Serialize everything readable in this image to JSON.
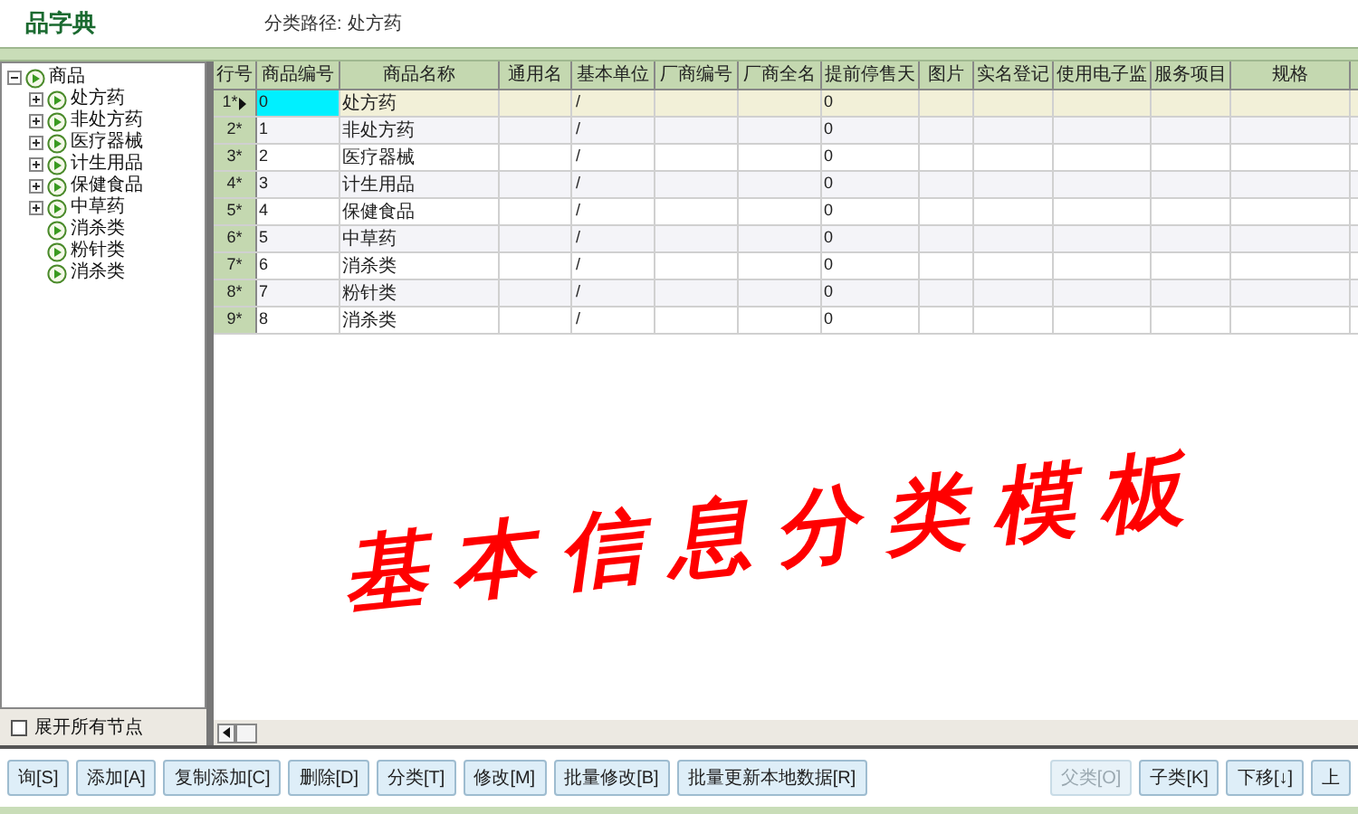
{
  "header": {
    "title": "品字典",
    "path_label": "分类路径:",
    "path_value": "处方药"
  },
  "tree": {
    "label": "商品",
    "expanded": true,
    "children": [
      {
        "label": "处方药",
        "expanded": false
      },
      {
        "label": "非处方药",
        "expanded": false
      },
      {
        "label": "医疗器械",
        "expanded": false
      },
      {
        "label": "计生用品",
        "expanded": false
      },
      {
        "label": "保健食品",
        "expanded": false
      },
      {
        "label": "中草药",
        "expanded": false
      },
      {
        "label": "消杀类"
      },
      {
        "label": "粉针类"
      },
      {
        "label": "消杀类"
      }
    ]
  },
  "expand_all": {
    "label": "展开所有节点",
    "checked": false
  },
  "table": {
    "columns": [
      "行号",
      "商品编号",
      "商品名称",
      "通用名",
      "基本单位",
      "厂商编号",
      "厂商全名",
      "提前停售天",
      "图片",
      "实名登记",
      "使用电子监",
      "服务项目",
      "规格"
    ],
    "rows": [
      {
        "row_no": "1*",
        "code": "0",
        "name": "处方药",
        "unit": "/",
        "days": "0",
        "selected": true
      },
      {
        "row_no": "2*",
        "code": "1",
        "name": "非处方药",
        "unit": "/",
        "days": "0",
        "selected": false
      },
      {
        "row_no": "3*",
        "code": "2",
        "name": "医疗器械",
        "unit": "/",
        "days": "0",
        "selected": false
      },
      {
        "row_no": "4*",
        "code": "3",
        "name": "计生用品",
        "unit": "/",
        "days": "0",
        "selected": false
      },
      {
        "row_no": "5*",
        "code": "4",
        "name": "保健食品",
        "unit": "/",
        "days": "0",
        "selected": false
      },
      {
        "row_no": "6*",
        "code": "5",
        "name": "中草药",
        "unit": "/",
        "days": "0",
        "selected": false
      },
      {
        "row_no": "7*",
        "code": "6",
        "name": "消杀类",
        "unit": "/",
        "days": "0",
        "selected": false
      },
      {
        "row_no": "8*",
        "code": "7",
        "name": "粉针类",
        "unit": "/",
        "days": "0",
        "selected": false
      },
      {
        "row_no": "9*",
        "code": "8",
        "name": "消杀类",
        "unit": "/",
        "days": "0",
        "selected": false
      }
    ]
  },
  "overlay_caption": "基本信息分类模板",
  "left_buttons": [
    {
      "label": "询[S]",
      "disabled": false
    },
    {
      "label": "添加[A]",
      "disabled": false
    },
    {
      "label": "复制添加[C]",
      "disabled": false
    },
    {
      "label": "删除[D]",
      "disabled": false
    },
    {
      "label": "分类[T]",
      "disabled": false
    },
    {
      "label": "修改[M]",
      "disabled": false
    },
    {
      "label": "批量修改[B]",
      "disabled": false
    },
    {
      "label": "批量更新本地数据[R]",
      "disabled": false
    }
  ],
  "right_buttons": [
    {
      "label": "父类[O]",
      "disabled": true
    },
    {
      "label": "子类[K]",
      "disabled": false
    },
    {
      "label": "下移[↓]",
      "disabled": false
    },
    {
      "label": "上",
      "disabled": false
    }
  ]
}
